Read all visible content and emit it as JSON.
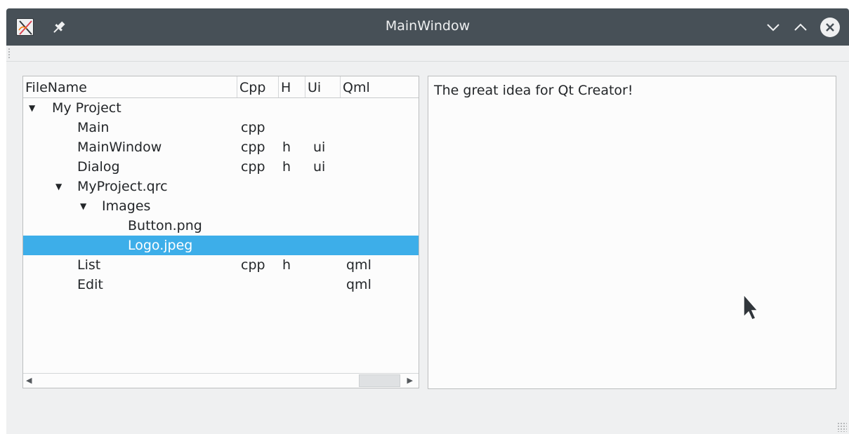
{
  "window": {
    "title": "MainWindow",
    "app_icon": "qt-creator-icon",
    "pin_icon": "pin-icon",
    "buttons": [
      "chevron-down-icon",
      "chevron-up-icon",
      "close-icon"
    ]
  },
  "tree": {
    "columns": [
      "FileName",
      "Cpp",
      "H",
      "Ui",
      "Qml"
    ],
    "rows": [
      {
        "name": "My Project",
        "expandable": true,
        "expanded": true,
        "cpp": "",
        "h": "",
        "ui": "",
        "qml": "",
        "selected": false
      },
      {
        "name": "Main",
        "cpp": "cpp",
        "h": "",
        "ui": "",
        "qml": "",
        "selected": false
      },
      {
        "name": "MainWindow",
        "cpp": "cpp",
        "h": "h",
        "ui": "ui",
        "qml": "",
        "selected": false
      },
      {
        "name": "Dialog",
        "cpp": "cpp",
        "h": "h",
        "ui": "ui",
        "qml": "",
        "selected": false
      },
      {
        "name": "MyProject.qrc",
        "expandable": true,
        "expanded": true,
        "cpp": "",
        "h": "",
        "ui": "",
        "qml": "",
        "selected": false
      },
      {
        "name": "Images",
        "expandable": true,
        "expanded": true,
        "cpp": "",
        "h": "",
        "ui": "",
        "qml": "",
        "selected": false
      },
      {
        "name": "Button.png",
        "cpp": "",
        "h": "",
        "ui": "",
        "qml": "",
        "selected": false
      },
      {
        "name": "Logo.jpeg",
        "cpp": "",
        "h": "",
        "ui": "",
        "qml": "",
        "selected": true
      },
      {
        "name": "List",
        "cpp": "cpp",
        "h": "h",
        "ui": "",
        "qml": "qml",
        "selected": false
      },
      {
        "name": "Edit",
        "cpp": "",
        "h": "",
        "ui": "",
        "qml": "qml",
        "selected": false
      }
    ]
  },
  "text_view": {
    "content": "The great idea for Qt Creator!"
  },
  "colors": {
    "titlebar": "#475057",
    "selection": "#3daee9",
    "window_bg": "#eff0f1",
    "view_bg": "#fcfcfc"
  }
}
